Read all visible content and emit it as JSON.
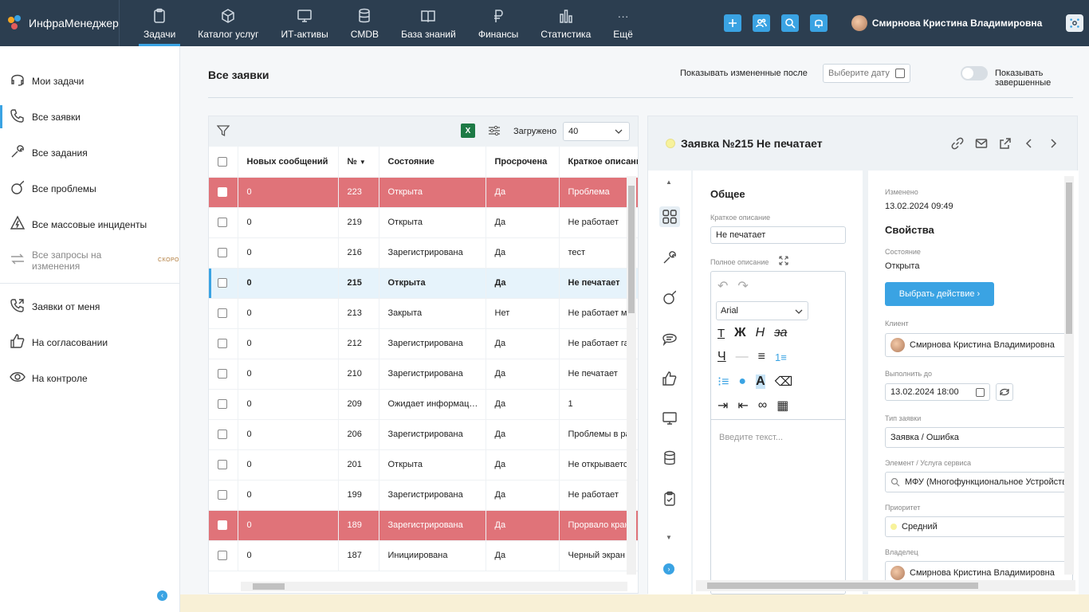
{
  "app": {
    "name": "ИнфраМенеджер"
  },
  "nav": {
    "items": [
      {
        "label": "Задачи",
        "icon": "clipboard-icon",
        "active": true
      },
      {
        "label": "Каталог услуг",
        "icon": "cube-icon"
      },
      {
        "label": "ИТ-активы",
        "icon": "monitor-icon"
      },
      {
        "label": "CMDB",
        "icon": "database-icon"
      },
      {
        "label": "База знаний",
        "icon": "book-icon"
      },
      {
        "label": "Финансы",
        "icon": "ruble-icon"
      },
      {
        "label": "Статистика",
        "icon": "bar-chart-icon"
      },
      {
        "label": "Ещё",
        "icon": "more-icon"
      }
    ]
  },
  "user": {
    "name": "Смирнова Кристина Владимировна"
  },
  "sidebar": {
    "items": [
      {
        "label": "Мои задачи",
        "icon": "headset-icon"
      },
      {
        "label": "Все заявки",
        "icon": "phone-icon",
        "active": true
      },
      {
        "label": "Все задания",
        "icon": "wrench-icon"
      },
      {
        "label": "Все проблемы",
        "icon": "bomb-icon"
      },
      {
        "label": "Все массовые инциденты",
        "icon": "warning-bolt-icon"
      },
      {
        "label": "Все запросы на изменения",
        "icon": "arrows-icon",
        "badge": "СКОРО"
      },
      {
        "label": "Заявки от меня",
        "icon": "phone-out-icon"
      },
      {
        "label": "На согласовании",
        "icon": "thumbs-up-icon"
      },
      {
        "label": "На контроле",
        "icon": "eye-icon"
      }
    ]
  },
  "page": {
    "title": "Все заявки",
    "changed_after_label": "Показывать измененные после",
    "date_placeholder": "Выберите дату",
    "show_completed_label": "Показывать завершенные"
  },
  "table": {
    "loaded_label": "Загружено",
    "loaded_value": "40",
    "columns": [
      "Новых сообщений",
      "№",
      "Состояние",
      "Просрочена",
      "Краткое описание"
    ],
    "rows": [
      {
        "new": "0",
        "num": "223",
        "state": "Открыта",
        "overdue": "Да",
        "desc": "Проблема",
        "style": "red"
      },
      {
        "new": "0",
        "num": "219",
        "state": "Открыта",
        "overdue": "Да",
        "desc": "Не работает",
        "style": ""
      },
      {
        "new": "0",
        "num": "216",
        "state": "Зарегистрирована",
        "overdue": "Да",
        "desc": "тест",
        "style": ""
      },
      {
        "new": "0",
        "num": "215",
        "state": "Открыта",
        "overdue": "Да",
        "desc": "Не печатает",
        "style": "sel"
      },
      {
        "new": "0",
        "num": "213",
        "state": "Закрыта",
        "overdue": "Нет",
        "desc": "Не работает м",
        "style": ""
      },
      {
        "new": "0",
        "num": "212",
        "state": "Зарегистрирована",
        "overdue": "Да",
        "desc": "Не работает га",
        "style": ""
      },
      {
        "new": "0",
        "num": "210",
        "state": "Зарегистрирована",
        "overdue": "Да",
        "desc": "Не печатает",
        "style": ""
      },
      {
        "new": "0",
        "num": "209",
        "state": "Ожидает информац…",
        "overdue": "Да",
        "desc": "1",
        "style": ""
      },
      {
        "new": "0",
        "num": "206",
        "state": "Зарегистрирована",
        "overdue": "Да",
        "desc": "Проблемы в ра",
        "style": ""
      },
      {
        "new": "0",
        "num": "201",
        "state": "Открыта",
        "overdue": "Да",
        "desc": "Не открывается",
        "style": ""
      },
      {
        "new": "0",
        "num": "199",
        "state": "Зарегистрирована",
        "overdue": "Да",
        "desc": "Не работает",
        "style": ""
      },
      {
        "new": "0",
        "num": "189",
        "state": "Зарегистрирована",
        "overdue": "Да",
        "desc": "Прорвало кран",
        "style": "red"
      },
      {
        "new": "0",
        "num": "187",
        "state": "Инициирована",
        "overdue": "Да",
        "desc": "Черный экран",
        "style": ""
      }
    ]
  },
  "detail": {
    "title": "Заявка №215 Не печатает",
    "general": {
      "title": "Общее",
      "short_desc_label": "Краткое описание",
      "short_desc_value": "Не печатает",
      "full_desc_label": "Полное описание",
      "font_value": "Arial",
      "editor_placeholder": "Введите текст..."
    },
    "props": {
      "changed_label": "Изменено",
      "changed_value": "13.02.2024 09:49",
      "title": "Свойства",
      "state_label": "Состояние",
      "state_value": "Открыта",
      "action_button": "Выбрать действие",
      "client_label": "Клиент",
      "client_value": "Смирнова Кристина Владимировна",
      "due_label": "Выполнить до",
      "due_value": "13.02.2024 18:00",
      "type_label": "Тип заявки",
      "type_value": "Заявка / Ошибка",
      "service_label": "Элемент / Услуга сервиса",
      "service_value": "МФУ (Многофункциональное Устройство)",
      "priority_label": "Приоритет",
      "priority_value": "Средний",
      "owner_label": "Владелец",
      "owner_value": "Смирнова Кристина Владимировна"
    }
  }
}
